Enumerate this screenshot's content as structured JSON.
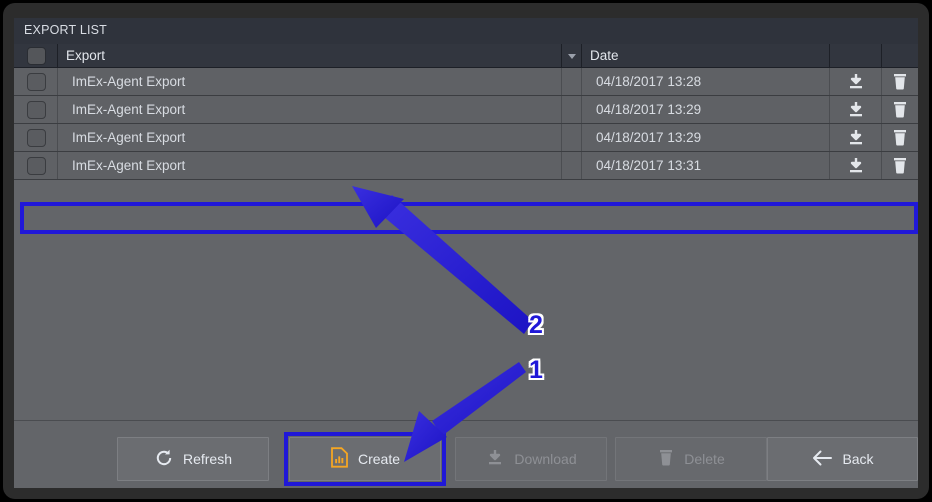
{
  "window": {
    "title": "EXPORT LIST",
    "frame_color": "#2c2c2c",
    "panel_background": "#636569",
    "titlebar_background": "#2f333c"
  },
  "table": {
    "columns": [
      {
        "key": "select",
        "label": "",
        "icon": "checkbox-icon"
      },
      {
        "key": "export",
        "label": "Export"
      },
      {
        "key": "sort",
        "label": "",
        "icon": "sort-descending-icon"
      },
      {
        "key": "date",
        "label": "Date"
      },
      {
        "key": "download",
        "label": ""
      },
      {
        "key": "delete",
        "label": ""
      }
    ],
    "rows": [
      {
        "name": "ImEx-Agent Export",
        "date": "04/18/2017 13:28",
        "checked": false,
        "highlighted": false
      },
      {
        "name": "ImEx-Agent Export",
        "date": "04/18/2017 13:29",
        "checked": false,
        "highlighted": false
      },
      {
        "name": "ImEx-Agent Export",
        "date": "04/18/2017 13:29",
        "checked": false,
        "highlighted": false
      },
      {
        "name": "ImEx-Agent Export",
        "date": "04/18/2017 13:31",
        "checked": false,
        "highlighted": true
      }
    ],
    "row_icons": {
      "download": "download-icon",
      "delete": "trash-icon"
    }
  },
  "footer": {
    "buttons": [
      {
        "key": "refresh",
        "label": "Refresh",
        "icon": "refresh-icon",
        "enabled": true,
        "highlighted": false
      },
      {
        "key": "create",
        "label": "Create",
        "icon": "create-report-icon",
        "enabled": true,
        "highlighted": true
      },
      {
        "key": "download",
        "label": "Download",
        "icon": "download-icon",
        "enabled": false,
        "highlighted": false
      },
      {
        "key": "delete",
        "label": "Delete",
        "icon": "trash-icon",
        "enabled": false,
        "highlighted": false
      },
      {
        "key": "back",
        "label": "Back",
        "icon": "arrow-left-icon",
        "enabled": true,
        "highlighted": false
      }
    ]
  },
  "annotations": {
    "highlight_color": "#2018d8",
    "create_icon_color": "#f5a623",
    "markers": [
      {
        "label": "1",
        "points_to": "create-button"
      },
      {
        "label": "2",
        "points_to": "highlighted-table-row"
      }
    ]
  }
}
